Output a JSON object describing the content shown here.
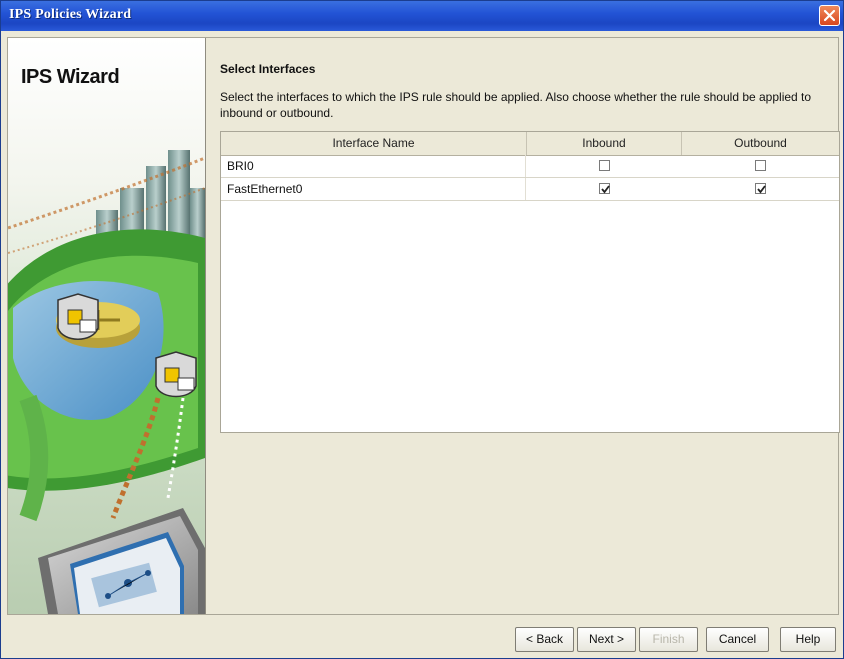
{
  "window": {
    "title": "IPS Policies Wizard"
  },
  "side_panel": {
    "heading": "IPS Wizard"
  },
  "page": {
    "section_title": "Select Interfaces",
    "instructions": "Select the interfaces to which the IPS rule should be applied. Also choose whether the rule should be applied to inbound or outbound."
  },
  "table": {
    "columns": [
      "Interface Name",
      "Inbound",
      "Outbound"
    ],
    "rows": [
      {
        "name": "BRI0",
        "inbound": false,
        "outbound": false
      },
      {
        "name": "FastEthernet0",
        "inbound": true,
        "outbound": true
      }
    ]
  },
  "buttons": {
    "back": "< Back",
    "next": "Next >",
    "finish": "Finish",
    "cancel": "Cancel",
    "help": "Help"
  },
  "colors": {
    "titlebar": "#2354d6",
    "window_bg": "#ece9d8",
    "close_button": "#d8461e"
  }
}
